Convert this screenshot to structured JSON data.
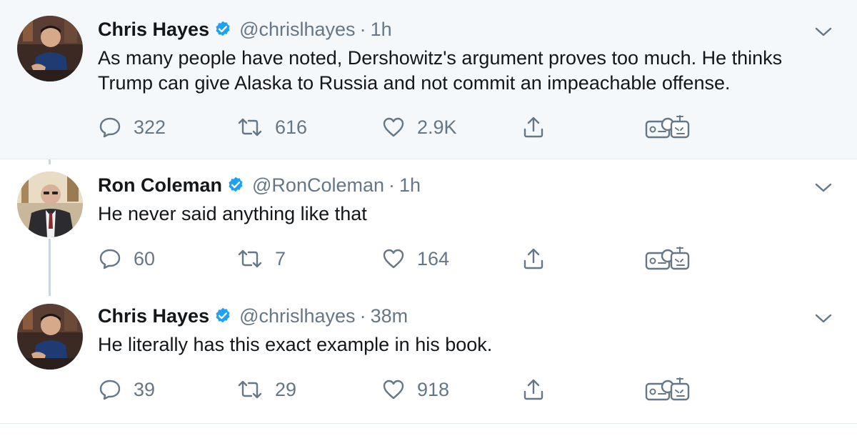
{
  "tweets": [
    {
      "name": "Chris Hayes",
      "handle": "@chrislhayes",
      "separator": "·",
      "time": "1h",
      "text": "As many people have noted, Dershowitz's argument proves too much. He thinks Trump can give Alaska to Russia and not commit an impeachable offense.",
      "replies": "322",
      "retweets": "616",
      "likes": "2.9K"
    },
    {
      "name": "Ron Coleman",
      "handle": "@RonColeman",
      "separator": "·",
      "time": "1h",
      "text": "He never said anything like that",
      "replies": "60",
      "retweets": "7",
      "likes": "164"
    },
    {
      "name": "Chris Hayes",
      "handle": "@chrislhayes",
      "separator": "·",
      "time": "38m",
      "text": "He literally has this exact example in his book.",
      "replies": "39",
      "retweets": "29",
      "likes": "918"
    }
  ],
  "icons": {
    "verified": "verified-badge-icon",
    "reply": "reply-icon",
    "retweet": "retweet-icon",
    "like": "heart-icon",
    "share": "share-icon",
    "bot": "bot-extension-icon",
    "chevron": "chevron-down-icon"
  },
  "colors": {
    "highlight_bg": "#f5f8fa",
    "verified_blue": "#1da1f2",
    "secondary_text": "#657786",
    "thread_line": "#ccd6dd"
  }
}
